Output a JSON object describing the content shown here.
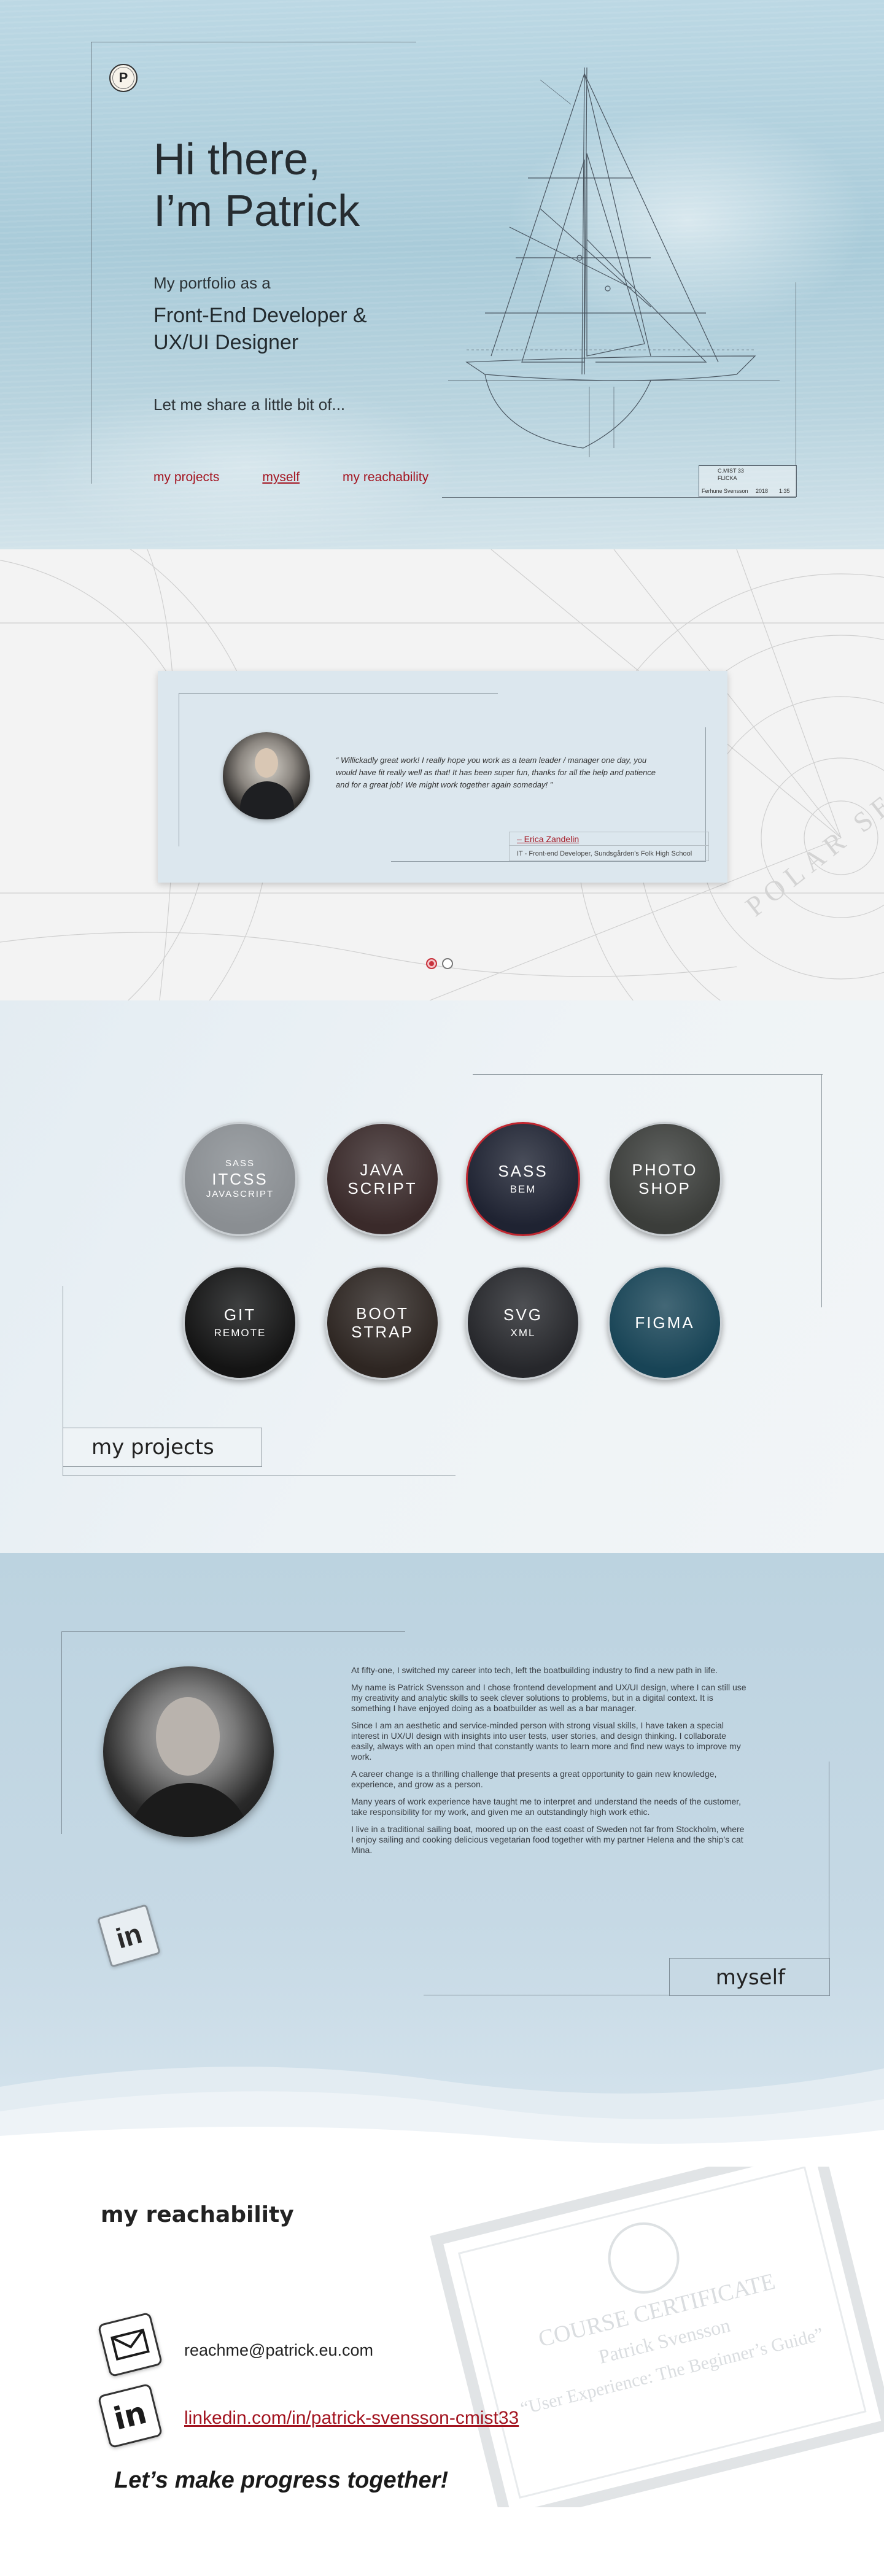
{
  "hero": {
    "logo_letter": "P",
    "title_line1": "Hi there,",
    "title_line2": "I’m Patrick",
    "subtitle": "My portfolio as a",
    "role_line1": "Front-End Developer &",
    "role_line2": "UX/UI Designer",
    "share": "Let me share a little bit of...",
    "nav": [
      {
        "label": "my projects",
        "active": false
      },
      {
        "label": "myself",
        "active": true
      },
      {
        "label": "my reachability",
        "active": false
      }
    ],
    "titleblock": {
      "a": "C.MIST 33",
      "b": "FLICKA",
      "c": "Ferhune Svensson",
      "d": "2018",
      "e": "1:35"
    }
  },
  "testimonial": {
    "quote": "“ Willickadly great work! I really hope you work as a team leader / manager one day, you would have fit really well as that! It has been super fun, thanks for all the help and patience and for a great job! We might work together again someday! ”",
    "author": "– Erica Zandelin",
    "role": "IT - Front-end Developer, Sundsgården’s Folk High School",
    "map_label": "POLAR SEA C",
    "dots": [
      true,
      false
    ]
  },
  "projects": {
    "title": "my projects",
    "items": [
      {
        "top": "SASS",
        "big": "ITCSS",
        "bottom": "JAVASCRIPT",
        "bg": "#8a8e92",
        "ring": "#c9ced2"
      },
      {
        "top": "",
        "big": "JAVA SCRIPT",
        "bottom": "",
        "bg": "#3a2a2a",
        "ring": "#c9ced2"
      },
      {
        "top": "",
        "big": "SASS",
        "bottom": "BEM",
        "bg": "#1f2332",
        "ring": "#c0262f"
      },
      {
        "top": "",
        "big": "PHOTO SHOP",
        "bottom": "",
        "bg": "#3b3d3a",
        "ring": "#c9ced2"
      },
      {
        "top": "",
        "big": "GIT",
        "bottom": "REMOTE",
        "bg": "#141414",
        "ring": "#c9ced2"
      },
      {
        "top": "",
        "big": "BOOT STRAP",
        "bottom": "",
        "bg": "#2e2622",
        "ring": "#c9ced2"
      },
      {
        "top": "",
        "big": "SVG",
        "bottom": "XML",
        "bg": "#26272b",
        "ring": "#c9ced2"
      },
      {
        "top": "",
        "big": "FIGMA",
        "bottom": "",
        "bg": "#184456",
        "ring": "#c9ced2"
      }
    ]
  },
  "myself": {
    "title": "myself",
    "linkedin_icon": "in",
    "paragraphs": [
      "At fifty-one, I switched my career into tech, left the boatbuilding industry to find a new path in life.",
      "My name is Patrick Svensson and I chose frontend development and UX/UI design, where I can still use my creativity and analytic skills to seek clever solutions to problems, but in a digital context. It is something I have enjoyed doing as a boatbuilder as well as a bar manager.",
      "Since I am an aesthetic and service-minded person with strong visual skills, I have taken a special interest in UX/UI design with insights into user tests, user stories, and design thinking. I collaborate easily, always with an open mind that constantly wants to learn more and find new ways to improve my work.",
      "A career change is a thrilling challenge that presents a great opportunity to gain new knowledge, experience, and grow as a person.",
      "Many years of work experience have taught me to interpret and understand the needs of the customer, take responsibility for my work, and given me an outstandingly high work ethic.",
      "I live in a traditional sailing boat, moored up on the east coast of Sweden not far from Stockholm, where I enjoy sailing and cooking delicious vegetarian food together with my partner Helena and the ship’s cat Mina."
    ]
  },
  "reach": {
    "title": "my reachability",
    "email": "reachme@patrick.eu.com",
    "linkedin": "linkedin.com/in/patrick-svensson-cmist33",
    "linkedin_icon": "in",
    "tagline": "Let’s make progress together!",
    "cert_title": "COURSE CERTIFICATE",
    "cert_name": "Patrick Svensson",
    "cert_course": "“User Experience: The Beginner’s Guide”"
  }
}
